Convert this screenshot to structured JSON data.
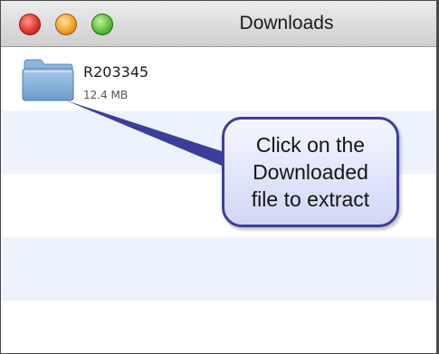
{
  "window": {
    "title": "Downloads"
  },
  "downloads": [
    {
      "name": "R203345",
      "size": "12.4 MB",
      "icon": "folder-icon"
    }
  ],
  "callout": {
    "lines": [
      "Click on the",
      "Downloaded",
      "file to extract"
    ]
  },
  "colors": {
    "row_alt": "#edf3fe",
    "callout_border": "#3b3f9a",
    "folder": "#7aa7d2"
  }
}
